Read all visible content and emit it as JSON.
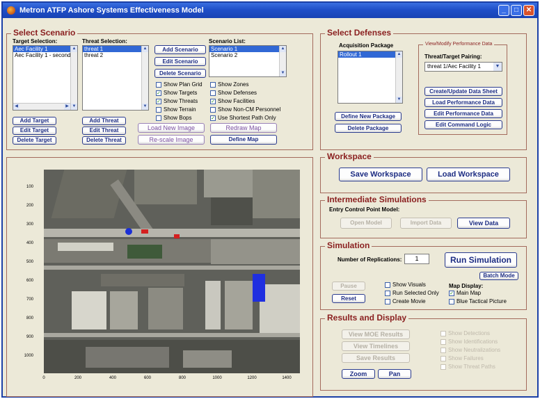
{
  "window": {
    "title": "Metron ATFP Ashore Systems Effectiveness Model",
    "icon": "app-logo-icon",
    "controls": [
      "minimize-icon",
      "maximize-icon",
      "close-icon"
    ]
  },
  "colors": {
    "titlebar": "#1f4fc8",
    "panel_title": "#8a1f1f",
    "button_text": "#1c2c82",
    "selection": "#3168d5"
  },
  "select_scenario": {
    "title": "Select Scenario",
    "target_label": "Target Selection:",
    "targets": [
      "Aec Facility 1",
      "Aec Facility 1 - second"
    ],
    "threat_label": "Threat Selection:",
    "threats": [
      "threat 1",
      "threat 2"
    ],
    "scenario_label": "Scenario List:",
    "scenarios": [
      "Scenario 1",
      "Scenario 2"
    ],
    "add_scenario": "Add Scenario",
    "edit_scenario": "Edit Scenario",
    "delete_scenario": "Delete Scenario",
    "add_target": "Add Target",
    "edit_target": "Edit Target",
    "delete_target": "Delete Target",
    "add_threat": "Add Threat",
    "edit_threat": "Edit Threat",
    "delete_threat": "Delete Threat",
    "load_new_image": "Load New Image",
    "rescale_image": "Re-scale Image",
    "redraw_map": "Redraw Map",
    "define_map": "Define Map",
    "checks_left": [
      {
        "label": "Show Plan Grid",
        "checked": false
      },
      {
        "label": "Show Targets",
        "checked": true
      },
      {
        "label": "Show Threats",
        "checked": true
      },
      {
        "label": "Show Terrain",
        "checked": false
      },
      {
        "label": "Show Bops",
        "checked": false
      }
    ],
    "checks_right": [
      {
        "label": "Show Zones",
        "checked": false
      },
      {
        "label": "Show Defenses",
        "checked": false
      },
      {
        "label": "Show Facilities",
        "checked": true
      },
      {
        "label": "Show Non-CM Personnel",
        "checked": false
      },
      {
        "label": "Use Shortest Path Only",
        "checked": true
      }
    ]
  },
  "select_defenses": {
    "title": "Select Defenses",
    "acq_label": "Acquisition Package",
    "packages": [
      "Rollout 1"
    ],
    "define_package": "Define New Package",
    "delete_package": "Delete Package",
    "perf_title": "View/Modify Performance Data",
    "pairing_label": "Threat/Target Pairing:",
    "pairing_value": "threat 1/Aec Facility 1",
    "create_sheet": "Create/Update Data Sheet",
    "load_perf": "Load Performance Data",
    "edit_perf": "Edit Performance Data",
    "edit_command": "Edit Command Logic"
  },
  "workspace": {
    "title": "Workspace",
    "save": "Save Workspace",
    "load": "Load Workspace"
  },
  "intermediate": {
    "title": "Intermediate Simulations",
    "ecp_label": "Entry Control Point Model:",
    "open_model": "Open Model",
    "import_data": "Import Data",
    "view_data": "View Data"
  },
  "simulation": {
    "title": "Simulation",
    "reps_label": "Number of Replications:",
    "reps_value": "1",
    "run": "Run Simulation",
    "batch": "Batch Mode",
    "pause": "Pause",
    "reset": "Reset",
    "checks": [
      {
        "label": "Show Visuals",
        "checked": false
      },
      {
        "label": "Run Selected Only",
        "checked": false
      },
      {
        "label": "Create Movie",
        "checked": false
      }
    ],
    "map_display_label": "Map Display:",
    "map_checks": [
      {
        "label": "Main Map",
        "checked": true
      },
      {
        "label": "Blue Tactical Picture",
        "checked": false
      }
    ]
  },
  "results": {
    "title": "Results and Display",
    "view_moe": "View MOE Results",
    "view_timelines": "View Timelines",
    "save_results": "Save Results",
    "zoom": "Zoom",
    "pan": "Pan",
    "checks": [
      "Show Detections",
      "Show Identifications",
      "Show Neutralizations",
      "Show Failures",
      "Show Threat Paths"
    ]
  },
  "map": {
    "y_ticks": [
      "100",
      "200",
      "300",
      "400",
      "500",
      "600",
      "700",
      "800",
      "900",
      "1000"
    ],
    "x_ticks": [
      "0",
      "200",
      "400",
      "600",
      "800",
      "1000",
      "1200",
      "1400"
    ]
  }
}
